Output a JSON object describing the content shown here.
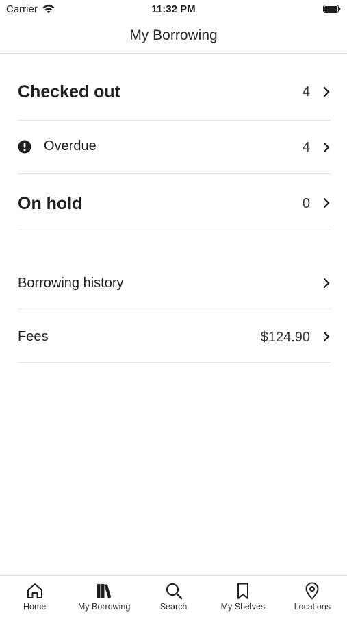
{
  "status_bar": {
    "carrier": "Carrier",
    "time": "11:32 PM"
  },
  "nav": {
    "title": "My Borrowing"
  },
  "rows": {
    "checked_out": {
      "label": "Checked out",
      "count": "4"
    },
    "overdue": {
      "label": "Overdue",
      "count": "4"
    },
    "on_hold": {
      "label": "On hold",
      "count": "0"
    },
    "history": {
      "label": "Borrowing history"
    },
    "fees": {
      "label": "Fees",
      "amount": "$124.90"
    }
  },
  "tabs": [
    {
      "label": "Home",
      "icon": "home-icon"
    },
    {
      "label": "My Borrowing",
      "icon": "books-icon"
    },
    {
      "label": "Search",
      "icon": "search-icon"
    },
    {
      "label": "My Shelves",
      "icon": "bookmark-icon"
    },
    {
      "label": "Locations",
      "icon": "location-pin-icon"
    }
  ],
  "colors": {
    "text": "#1f1f1f",
    "divider": "#e0e0e0"
  }
}
